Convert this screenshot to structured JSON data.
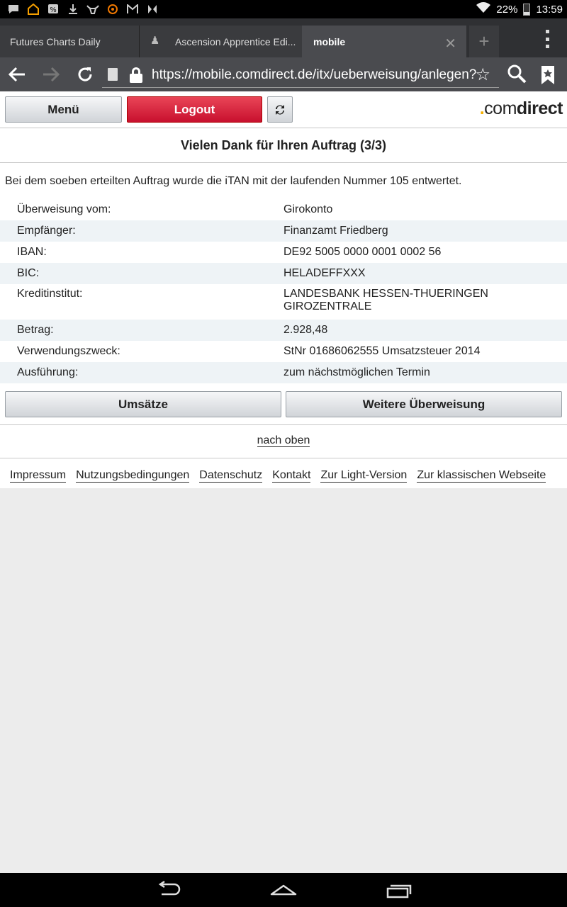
{
  "status_bar": {
    "battery": "22%",
    "time": "13:59",
    "icons": [
      "chat-icon",
      "home-alert-icon",
      "percent-icon",
      "download-icon",
      "bull-icon",
      "app-icon",
      "gmail-icon",
      "media-icon"
    ]
  },
  "tabs": [
    {
      "label": "Futures Charts Daily"
    },
    {
      "label": "Ascension Apprentice Edi..."
    },
    {
      "label": "mobile"
    }
  ],
  "url": "https://mobile.comdirect.de/itx/ueberweisung/anlegen?",
  "nav": {
    "menu_label": "Menü",
    "logout_label": "Logout"
  },
  "logo": {
    "dot": ".",
    "com": "com",
    "direct": "direct"
  },
  "heading": "Vielen Dank für Ihren Auftrag (3/3)",
  "info_text": "Bei dem soeben erteilten Auftrag wurde die iTAN mit der laufenden Nummer 105 entwertet.",
  "details": [
    {
      "label": "Überweisung vom:",
      "value": "Girokonto"
    },
    {
      "label": "Empfänger:",
      "value": "Finanzamt Friedberg"
    },
    {
      "label": "IBAN:",
      "value": "DE92 5005 0000 0001 0002 56"
    },
    {
      "label": "BIC:",
      "value": "HELADEFFXXX"
    },
    {
      "label": "Kreditinstitut:",
      "value": "LANDESBANK HESSEN-THUERINGEN",
      "value2": "GIROZENTRALE"
    },
    {
      "label": "Betrag:",
      "value": "2.928,48"
    },
    {
      "label": "Verwendungszweck:",
      "value": "StNr 01686062555 Umsatzsteuer 2014"
    },
    {
      "label": "Ausführung:",
      "value": "zum nächstmöglichen Termin"
    }
  ],
  "buttons": {
    "umsatze": "Umsätze",
    "weitere": "Weitere Überweisung"
  },
  "top_link": "nach oben",
  "footer": [
    "Impressum",
    "Nutzungsbedingungen",
    "Datenschutz",
    "Kontakt",
    "Zur Light-Version",
    "Zur klassischen Webseite"
  ]
}
